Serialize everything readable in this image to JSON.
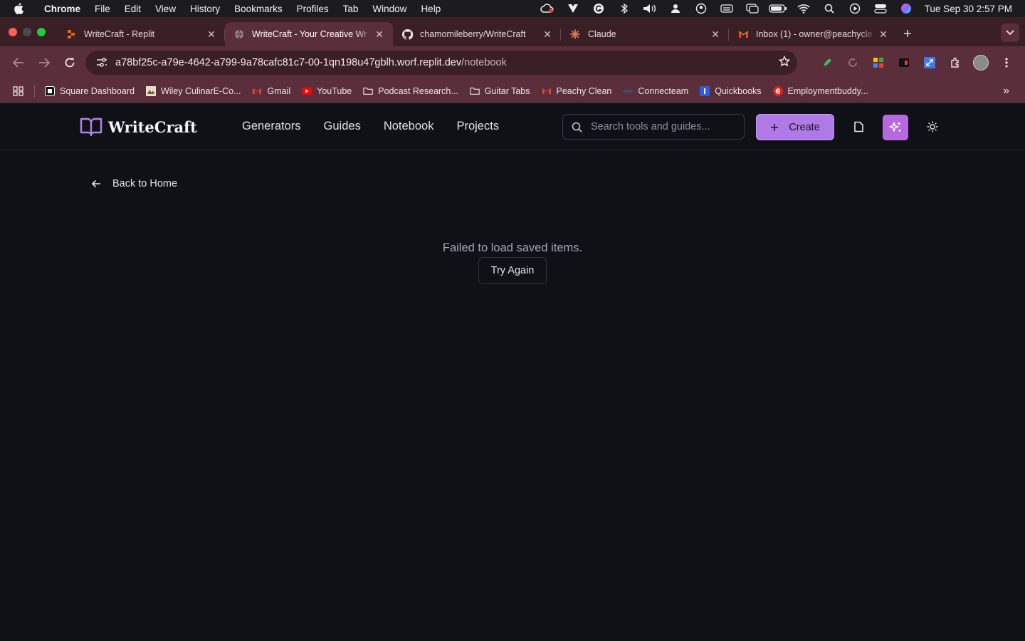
{
  "menubar": {
    "app": "Chrome",
    "items": [
      "File",
      "Edit",
      "View",
      "History",
      "Bookmarks",
      "Profiles",
      "Tab",
      "Window",
      "Help"
    ],
    "clock": "Tue Sep 30  2:57 PM"
  },
  "tabs": [
    {
      "title": "WriteCraft - Replit",
      "icon": "replit-icon"
    },
    {
      "title": "WriteCraft - Your Creative Wr",
      "icon": "globe-icon"
    },
    {
      "title": "chamomileberry/WriteCraft",
      "icon": "github-icon"
    },
    {
      "title": "Claude",
      "icon": "claude-icon"
    },
    {
      "title": "Inbox (1) - owner@peachycle",
      "icon": "gmail-icon"
    }
  ],
  "address": {
    "host": "a78bf25c-a79e-4642-a799-9a78cafc81c7-00-1qn198u47gblh.worf.replit.dev",
    "path": "/notebook"
  },
  "bookmarks": [
    {
      "label": "Square Dashboard",
      "icon": "square-icon"
    },
    {
      "label": "Wiley CulinarE-Co...",
      "icon": "wiley-icon"
    },
    {
      "label": "Gmail",
      "icon": "gmail-icon"
    },
    {
      "label": "YouTube",
      "icon": "youtube-icon"
    },
    {
      "label": "Podcast Research...",
      "icon": "folder-icon"
    },
    {
      "label": "Guitar Tabs",
      "icon": "folder-icon"
    },
    {
      "label": "Peachy Clean",
      "icon": "gmail-icon"
    },
    {
      "label": "Connecteam",
      "icon": "connecteam-icon"
    },
    {
      "label": "Quickbooks",
      "icon": "quickbooks-icon"
    },
    {
      "label": "Employmentbuddy...",
      "icon": "employmentbuddy-icon"
    }
  ],
  "app": {
    "logo": "WriteCraft",
    "nav": [
      "Generators",
      "Guides",
      "Notebook",
      "Projects"
    ],
    "search_placeholder": "Search tools and guides...",
    "create_label": "Create"
  },
  "main": {
    "back_label": "Back to Home",
    "error_message": "Failed to load saved items.",
    "retry_label": "Try Again"
  },
  "colors": {
    "page_bg": "#0f1117",
    "chrome_frame": "#5a2f3b",
    "accent": "#b07ae6"
  }
}
